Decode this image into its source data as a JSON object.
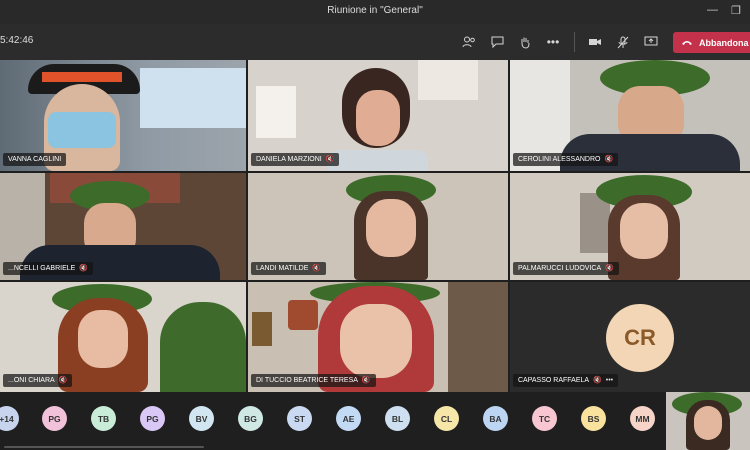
{
  "window": {
    "title": "Riunione in \"General\""
  },
  "toolbar": {
    "timer": "5:42:46",
    "leave_label": "Abbandona"
  },
  "participants": [
    {
      "name": "VANNA CAGLINI",
      "muted": false
    },
    {
      "name": "DANIELA MARZIONI",
      "muted": true
    },
    {
      "name": "CEROLINI ALESSANDRO",
      "muted": true
    },
    {
      "name": "...NCELLI GABRIELE",
      "muted": true
    },
    {
      "name": "LANDI MATILDE",
      "muted": true
    },
    {
      "name": "PALMARUCCI LUDOVICA",
      "muted": true
    },
    {
      "name": "...ONI CHIARA",
      "muted": true
    },
    {
      "name": "DI TUCCIO BEATRICE TERESA",
      "muted": true
    },
    {
      "name": "CAPASSO RAFFAELA",
      "muted": true,
      "initials": "CR",
      "has_more": true
    }
  ],
  "strip": {
    "overflow": "+14",
    "avatars": [
      {
        "initials": "PG",
        "color": "#f1c2d9"
      },
      {
        "initials": "TB",
        "color": "#c9ecd9"
      },
      {
        "initials": "PG",
        "color": "#d9c8f5"
      },
      {
        "initials": "BV",
        "color": "#d2e6f2"
      },
      {
        "initials": "BG",
        "color": "#cfe8e4"
      },
      {
        "initials": "ST",
        "color": "#c9d9f1"
      },
      {
        "initials": "AE",
        "color": "#c3daf5"
      },
      {
        "initials": "BL",
        "color": "#cddff0"
      },
      {
        "initials": "CL",
        "color": "#f6e6a8"
      },
      {
        "initials": "BA",
        "color": "#bcd5f2"
      },
      {
        "initials": "TC",
        "color": "#f7c6d0"
      },
      {
        "initials": "BS",
        "color": "#f8e29d"
      },
      {
        "initials": "MM",
        "color": "#f6d4c8"
      }
    ]
  },
  "colors": {
    "leave": "#c4314b",
    "avatar_cr_bg": "#f3d6b5",
    "avatar_cr_text": "#8b5a2b"
  }
}
